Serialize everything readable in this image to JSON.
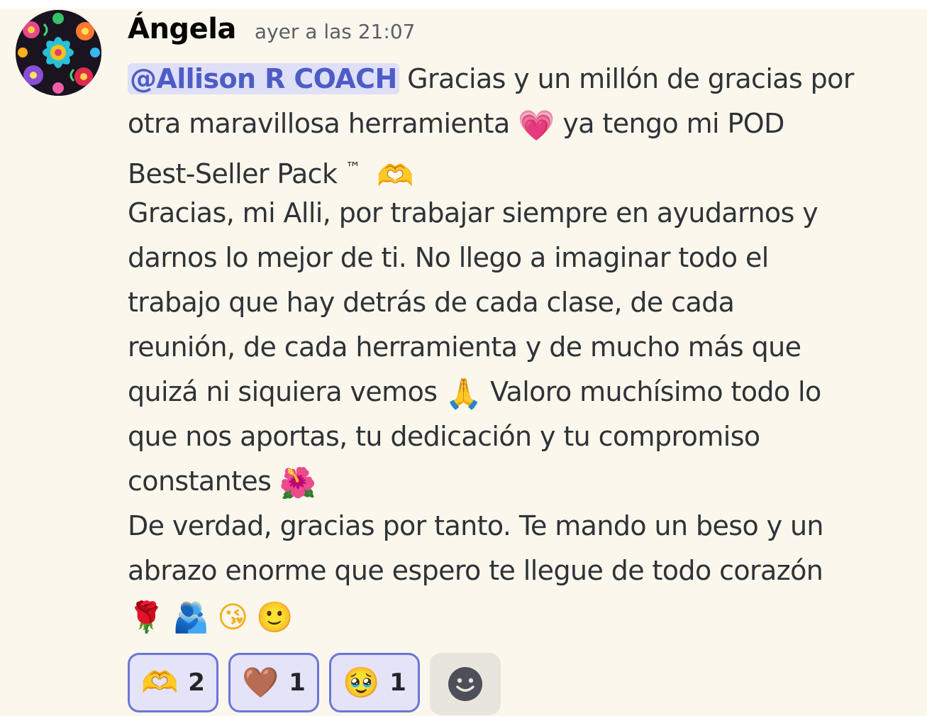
{
  "message": {
    "author": "Ángela",
    "timestamp": "ayer a las 21:07",
    "mention": "@Allison R COACH",
    "lines": [
      " Gracias y un millón de gracias por",
      "otra maravillosa herramienta ",
      " ya tengo mi POD",
      "Best-Seller Pack ",
      "™",
      "Gracias, mi Alli, por trabajar siempre en ayudarnos y",
      "darnos lo mejor de ti. No llego a imaginar todo el",
      "trabajo que hay detrás de cada clase, de cada",
      "reunión, de cada herramienta y de mucho más que",
      "quizá ni siquiera vemos ",
      " Valoro muchísimo todo lo",
      "que nos aportas, tu dedicación y tu compromiso",
      "constantes ",
      "De verdad, gracias por tanto. Te mando un beso y un",
      "abrazo enorme que espero te llegue de todo corazón"
    ],
    "emojis": {
      "heart": "💗",
      "heart_hands": "🫶",
      "pray": "🙏",
      "hibiscus": "🌺",
      "rose": "🌹",
      "hug": "🫂",
      "kiss": "😘",
      "smile": "🙂"
    }
  },
  "reactions": [
    {
      "emoji": "🫶",
      "count": "2",
      "icon": "heart-hands-icon"
    },
    {
      "emoji": "🤎",
      "count": "1",
      "icon": "brown-heart-icon"
    },
    {
      "emoji": "🥹",
      "count": "1",
      "icon": "pleading-face-icon"
    }
  ],
  "add_reaction_icon": "smiley-add-icon",
  "colors": {
    "background": "#fbf7ec",
    "mention_bg": "#dfe0f7",
    "mention_text": "#4e5cc7",
    "reaction_border": "#6a76d6",
    "reaction_bg": "#e5e3f7"
  }
}
